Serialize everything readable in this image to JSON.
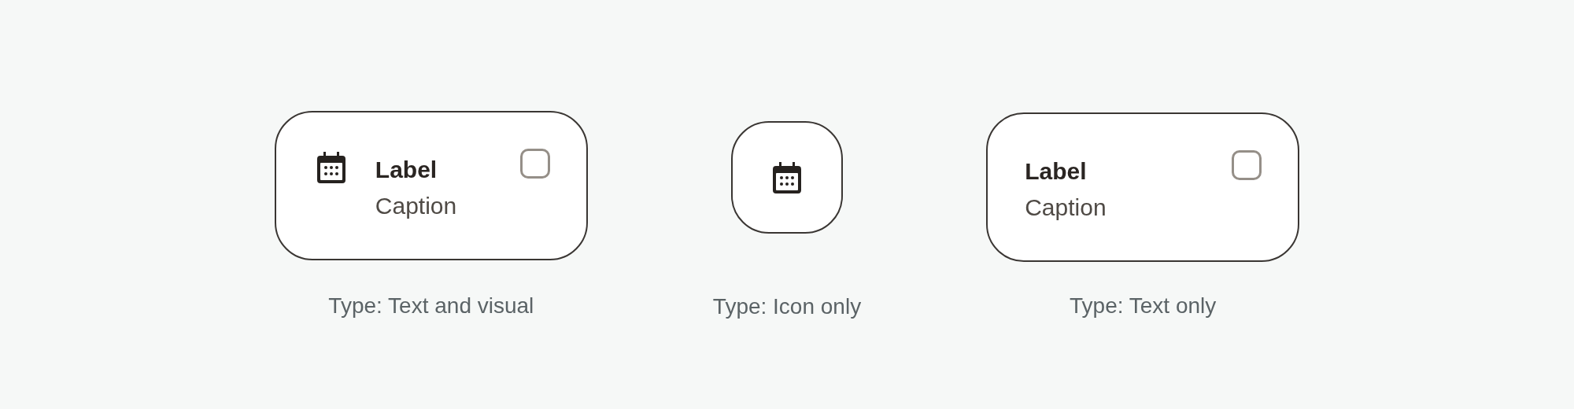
{
  "variants": [
    {
      "kind": "text_visual",
      "label": "Label",
      "caption": "Caption",
      "checked": false,
      "type_label": "Type: Text and visual"
    },
    {
      "kind": "icon",
      "type_label": "Type: Icon only"
    },
    {
      "kind": "text",
      "label": "Label",
      "caption": "Caption",
      "checked": false,
      "type_label": "Type: Text only"
    }
  ]
}
